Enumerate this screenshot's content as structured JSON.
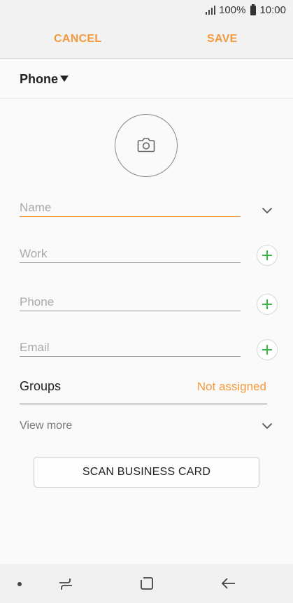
{
  "status_bar": {
    "battery": "100%",
    "time": "10:00",
    "icons": [
      "signal-icon",
      "battery-icon"
    ]
  },
  "action_bar": {
    "cancel_label": "CANCEL",
    "save_label": "SAVE"
  },
  "account": {
    "label": "Phone",
    "icon": "caret-down-icon"
  },
  "photo": {
    "icon": "camera-icon"
  },
  "fields": {
    "name": {
      "placeholder": "Name",
      "value": ""
    },
    "work": {
      "placeholder": "Work",
      "value": ""
    },
    "phone": {
      "placeholder": "Phone",
      "value": ""
    },
    "email": {
      "placeholder": "Email",
      "value": ""
    }
  },
  "groups": {
    "label": "Groups",
    "value": "Not assigned"
  },
  "view_more": {
    "label": "View more"
  },
  "scan_button": {
    "label": "SCAN BUSINESS CARD"
  },
  "nav_bar": {
    "icons": [
      "dot-icon",
      "recent-apps-icon",
      "home-icon",
      "back-icon"
    ]
  },
  "colors": {
    "accent": "#f49a3c",
    "add": "#3bb54a",
    "background": "#fafafa"
  }
}
